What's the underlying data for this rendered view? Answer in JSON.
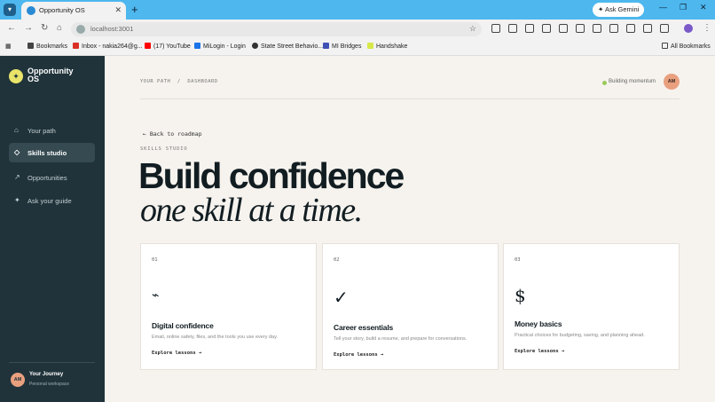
{
  "browser": {
    "tab_title": "Opportunity OS",
    "new_tab": "+",
    "gemini_label": "Ask Gemini",
    "url": "localhost:3001",
    "bookmarks": [
      {
        "label": "Bookmarks",
        "color": "#444444"
      },
      {
        "label": "Inbox - nakia264@g...",
        "color": "#d93025"
      },
      {
        "label": "(17) YouTube",
        "color": "#ff0000"
      },
      {
        "label": "MiLogin - Login",
        "color": "#1a73e8"
      },
      {
        "label": "State Street Behavio...",
        "color": "#333333"
      },
      {
        "label": "MI Bridges",
        "color": "#3f51b5"
      },
      {
        "label": "Handshake",
        "color": "#d7e84a"
      }
    ],
    "all_bookmarks": "All Bookmarks"
  },
  "sidebar": {
    "logo_mark": "✦",
    "logo_text": "Opportunity OS",
    "items": [
      {
        "icon": "⌂",
        "label": "Your path"
      },
      {
        "icon": "◇",
        "label": "Skills studio"
      },
      {
        "icon": "↗",
        "label": "Opportunities"
      },
      {
        "icon": "✦",
        "label": "Ask your guide"
      }
    ],
    "user": {
      "initials": "AM",
      "name": "Your Journey",
      "subtitle": "Personal workspace"
    }
  },
  "header": {
    "breadcrumb": "YOUR PATH  /  DASHBOARD",
    "status": "Building momentum",
    "avatar": "AM"
  },
  "main": {
    "back_link": "← Back to roadmap",
    "eyebrow": "SKILLS STUDIO",
    "headline": "Build confidence",
    "headline_italic": "one skill at a time.",
    "cards": [
      {
        "number": "01",
        "icon": "⌁",
        "title": "Digital confidence",
        "description": "Email, online safety, files, and the tools you use every day.",
        "link": "Explore lessons →"
      },
      {
        "number": "02",
        "icon": "✓",
        "title": "Career essentials",
        "description": "Tell your story, build a resume, and prepare for conversations.",
        "link": "Explore lessons →"
      },
      {
        "number": "03",
        "icon": "$",
        "title": "Money basics",
        "description": "Practical choices for budgeting, saving, and planning ahead.",
        "link": "Explore lessons →"
      }
    ]
  }
}
